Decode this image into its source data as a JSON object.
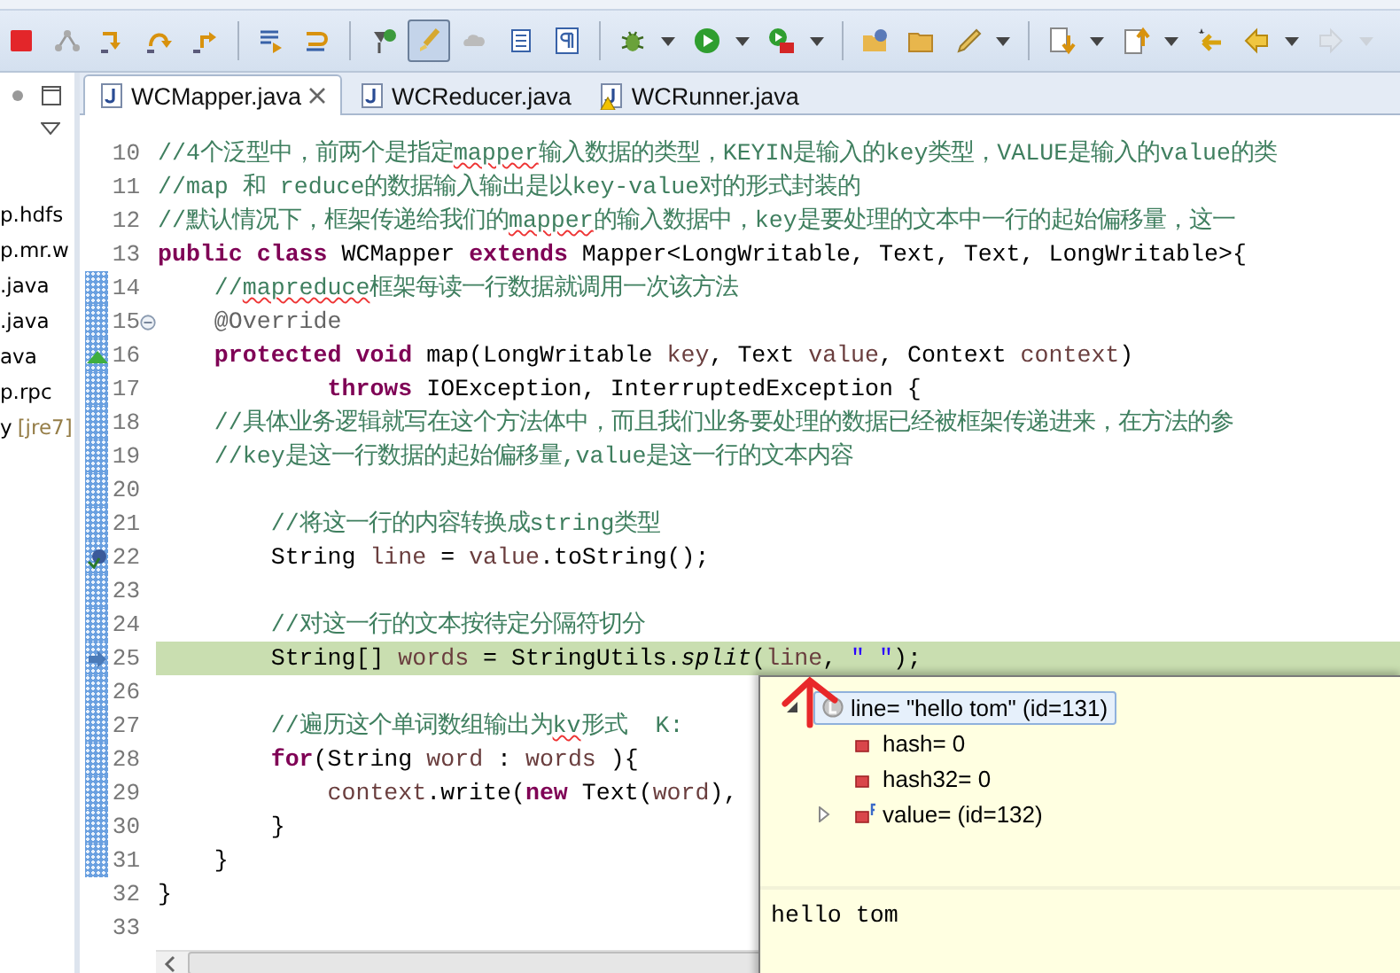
{
  "toolbar": {
    "groups": [
      [
        {
          "kind": "stop",
          "pressed": false,
          "dropdown": false,
          "disabled": false
        },
        {
          "kind": "disconnect",
          "pressed": false,
          "dropdown": false,
          "disabled": false
        },
        {
          "kind": "step-into",
          "pressed": false,
          "dropdown": false,
          "disabled": false
        },
        {
          "kind": "step-over",
          "pressed": false,
          "dropdown": false,
          "disabled": false
        },
        {
          "kind": "step-return",
          "pressed": false,
          "dropdown": false,
          "disabled": false
        }
      ],
      [
        {
          "kind": "drop-frame",
          "pressed": false,
          "dropdown": false,
          "disabled": false
        },
        {
          "kind": "step-filters",
          "pressed": false,
          "dropdown": false,
          "disabled": false
        }
      ],
      [
        {
          "kind": "new-class",
          "pressed": false,
          "dropdown": false,
          "disabled": false
        },
        {
          "kind": "highlight",
          "pressed": true,
          "dropdown": false,
          "disabled": false
        },
        {
          "kind": "block-select",
          "pressed": false,
          "dropdown": false,
          "disabled": false
        },
        {
          "kind": "frame",
          "pressed": false,
          "dropdown": false,
          "disabled": false
        },
        {
          "kind": "whitespace",
          "pressed": false,
          "dropdown": false,
          "disabled": false
        }
      ],
      [
        {
          "kind": "debug",
          "pressed": false,
          "dropdown": true,
          "disabled": false
        },
        {
          "kind": "run",
          "pressed": false,
          "dropdown": true,
          "disabled": false
        },
        {
          "kind": "run-external",
          "pressed": false,
          "dropdown": true,
          "disabled": false
        }
      ],
      [
        {
          "kind": "open-type",
          "pressed": false,
          "dropdown": false,
          "disabled": false
        },
        {
          "kind": "open-folder",
          "pressed": false,
          "dropdown": false,
          "disabled": false
        },
        {
          "kind": "pen",
          "pressed": false,
          "dropdown": true,
          "disabled": false
        }
      ],
      [
        {
          "kind": "next-annotation",
          "pressed": false,
          "dropdown": true,
          "disabled": false
        },
        {
          "kind": "prev-annotation",
          "pressed": false,
          "dropdown": true,
          "disabled": false
        },
        {
          "kind": "last-edit",
          "pressed": false,
          "dropdown": false,
          "disabled": false
        },
        {
          "kind": "back",
          "pressed": false,
          "dropdown": true,
          "disabled": false
        },
        {
          "kind": "forward",
          "pressed": false,
          "dropdown": true,
          "disabled": true
        }
      ]
    ]
  },
  "explorer": {
    "items": [
      {
        "label": "p.hdfs"
      },
      {
        "label": "p.mr.w"
      },
      {
        "label": ".java"
      },
      {
        "label": ".java"
      },
      {
        "label": "ava"
      },
      {
        "label": "p.rpc"
      },
      {
        "label": "y",
        "decoration": "[jre7]"
      }
    ]
  },
  "editor": {
    "tabs": [
      {
        "label": "WCMapper.java",
        "selected": true,
        "warning": false
      },
      {
        "label": "WCReducer.java",
        "selected": false,
        "warning": false
      },
      {
        "label": "WCRunner.java",
        "selected": false,
        "warning": true
      }
    ],
    "lines": [
      {
        "number": "10",
        "kind": "plain",
        "changed": false,
        "highlighted": false,
        "tokens": [
          {
            "kind": "comment",
            "text": "//4个泛型中，前两个是指定"
          },
          {
            "kind": "misspelled",
            "text": "mapper"
          },
          {
            "kind": "comment",
            "text": "输入数据的类型，KEYIN是输入的key类型，VALUE是输入的value的类"
          }
        ]
      },
      {
        "number": "11",
        "kind": "plain",
        "changed": false,
        "highlighted": false,
        "tokens": [
          {
            "kind": "comment",
            "text": "//map 和 reduce的数据输入输出是以key-value对的形式封装的"
          }
        ]
      },
      {
        "number": "12",
        "kind": "plain",
        "changed": false,
        "highlighted": false,
        "tokens": [
          {
            "kind": "comment",
            "text": "//默认情况下，框架传递给我们的"
          },
          {
            "kind": "misspelled",
            "text": "mapper"
          },
          {
            "kind": "comment",
            "text": "的输入数据中，key是要处理的文本中一行的起始偏移量，这一"
          }
        ]
      },
      {
        "number": "13",
        "kind": "plain",
        "changed": false,
        "highlighted": false,
        "tokens": [
          {
            "kind": "keyword",
            "text": "public class"
          },
          {
            "kind": "plain",
            "text": " WCMapper "
          },
          {
            "kind": "keyword",
            "text": "extends"
          },
          {
            "kind": "plain",
            "text": " Mapper<LongWritable, Text, Text, LongWritable>{"
          }
        ]
      },
      {
        "number": "14",
        "kind": "plain",
        "changed": true,
        "highlighted": false,
        "tokens": [
          {
            "kind": "comment",
            "text": "    //"
          },
          {
            "kind": "misspelled",
            "text": "mapreduce"
          },
          {
            "kind": "comment",
            "text": "框架每读一行数据就调用一次该方法"
          }
        ]
      },
      {
        "number": "15",
        "kind": "fold",
        "changed": true,
        "highlighted": false,
        "tokens": [
          {
            "kind": "annotation",
            "text": "    @Override"
          }
        ]
      },
      {
        "number": "16",
        "kind": "override",
        "changed": true,
        "highlighted": false,
        "tokens": [
          {
            "kind": "keyword",
            "text": "    protected void"
          },
          {
            "kind": "plain",
            "text": " map(LongWritable "
          },
          {
            "kind": "variable",
            "text": "key"
          },
          {
            "kind": "plain",
            "text": ", Text "
          },
          {
            "kind": "variable",
            "text": "value"
          },
          {
            "kind": "plain",
            "text": ", Context "
          },
          {
            "kind": "variable",
            "text": "context"
          },
          {
            "kind": "plain",
            "text": ")"
          }
        ]
      },
      {
        "number": "17",
        "kind": "plain",
        "changed": true,
        "highlighted": false,
        "tokens": [
          {
            "kind": "keyword",
            "text": "            throws"
          },
          {
            "kind": "plain",
            "text": " IOException, InterruptedException {"
          }
        ]
      },
      {
        "number": "18",
        "kind": "plain",
        "changed": true,
        "highlighted": false,
        "tokens": [
          {
            "kind": "comment",
            "text": "    //具体业务逻辑就写在这个方法体中，而且我们业务要处理的数据已经被框架传递进来，在方法的参"
          }
        ]
      },
      {
        "number": "19",
        "kind": "plain",
        "changed": true,
        "highlighted": false,
        "tokens": [
          {
            "kind": "comment",
            "text": "    //key是这一行数据的起始偏移量,value是这一行的文本内容"
          }
        ]
      },
      {
        "number": "20",
        "kind": "plain",
        "changed": true,
        "highlighted": false
      },
      {
        "number": "21",
        "kind": "plain",
        "changed": true,
        "highlighted": false,
        "tokens": [
          {
            "kind": "comment",
            "text": "        //将这一行的内容转换成string类型"
          }
        ]
      },
      {
        "number": "22",
        "kind": "breakpoint",
        "changed": true,
        "highlighted": false,
        "tokens": [
          {
            "kind": "plain",
            "text": "        String "
          },
          {
            "kind": "variable",
            "text": "line"
          },
          {
            "kind": "plain",
            "text": " = "
          },
          {
            "kind": "variable",
            "text": "value"
          },
          {
            "kind": "plain",
            "text": ".toString();"
          }
        ]
      },
      {
        "number": "23",
        "kind": "plain",
        "changed": true,
        "highlighted": false
      },
      {
        "number": "24",
        "kind": "plain",
        "changed": true,
        "highlighted": false,
        "tokens": [
          {
            "kind": "comment",
            "text": "        //对这一行的文本按待定分隔符切分"
          }
        ]
      },
      {
        "number": "25",
        "kind": "current",
        "changed": true,
        "highlighted": true,
        "tokens": [
          {
            "kind": "plain",
            "text": "        String[] "
          },
          {
            "kind": "variable",
            "text": "words"
          },
          {
            "kind": "plain",
            "text": " = StringUtils."
          },
          {
            "kind": "italic",
            "text": "split"
          },
          {
            "kind": "plain",
            "text": "("
          },
          {
            "kind": "variable",
            "text": "line"
          },
          {
            "kind": "plain",
            "text": ", "
          },
          {
            "kind": "string",
            "text": "\" \""
          },
          {
            "kind": "plain",
            "text": ");"
          }
        ]
      },
      {
        "number": "26",
        "kind": "plain",
        "changed": true,
        "highlighted": false
      },
      {
        "number": "27",
        "kind": "plain",
        "changed": true,
        "highlighted": false,
        "tokens": [
          {
            "kind": "comment",
            "text": "        //遍历这个单词数组输出为"
          },
          {
            "kind": "misspelled",
            "text": "kv"
          },
          {
            "kind": "comment",
            "text": "形式  K:"
          }
        ]
      },
      {
        "number": "28",
        "kind": "plain",
        "changed": true,
        "highlighted": false,
        "tokens": [
          {
            "kind": "keyword",
            "text": "        for"
          },
          {
            "kind": "plain",
            "text": "(String "
          },
          {
            "kind": "variable",
            "text": "word"
          },
          {
            "kind": "plain",
            "text": " : "
          },
          {
            "kind": "variable",
            "text": "words"
          },
          {
            "kind": "plain",
            "text": " ){"
          }
        ]
      },
      {
        "number": "29",
        "kind": "plain",
        "changed": true,
        "highlighted": false,
        "tokens": [
          {
            "kind": "variable",
            "text": "            context"
          },
          {
            "kind": "plain",
            "text": ".write("
          },
          {
            "kind": "keyword",
            "text": "new"
          },
          {
            "kind": "plain",
            "text": " Text("
          },
          {
            "kind": "variable",
            "text": "word"
          },
          {
            "kind": "plain",
            "text": "),"
          }
        ]
      },
      {
        "number": "30",
        "kind": "plain",
        "changed": true,
        "highlighted": false,
        "tokens": [
          {
            "kind": "plain",
            "text": "        }"
          }
        ]
      },
      {
        "number": "31",
        "kind": "plain",
        "changed": true,
        "highlighted": false,
        "tokens": [
          {
            "kind": "plain",
            "text": "    }"
          }
        ]
      },
      {
        "number": "32",
        "kind": "plain",
        "changed": false,
        "highlighted": false,
        "tokens": [
          {
            "kind": "plain",
            "text": "}"
          }
        ]
      },
      {
        "number": "33",
        "kind": "plain",
        "changed": false,
        "highlighted": false
      }
    ]
  },
  "inspect_popup": {
    "tree": [
      {
        "label": "line= \"hello tom\" (id=131)",
        "kind": "local",
        "final": false,
        "selected": true,
        "expanded": true,
        "children": [
          {
            "label": "hash= 0",
            "kind": "field",
            "final": false,
            "selected": false
          },
          {
            "label": "hash32= 0",
            "kind": "field",
            "final": false,
            "selected": false
          },
          {
            "label": "value= (id=132)",
            "kind": "field",
            "final": true,
            "selected": false,
            "expanded": false
          }
        ]
      }
    ],
    "detail": "hello tom"
  }
}
